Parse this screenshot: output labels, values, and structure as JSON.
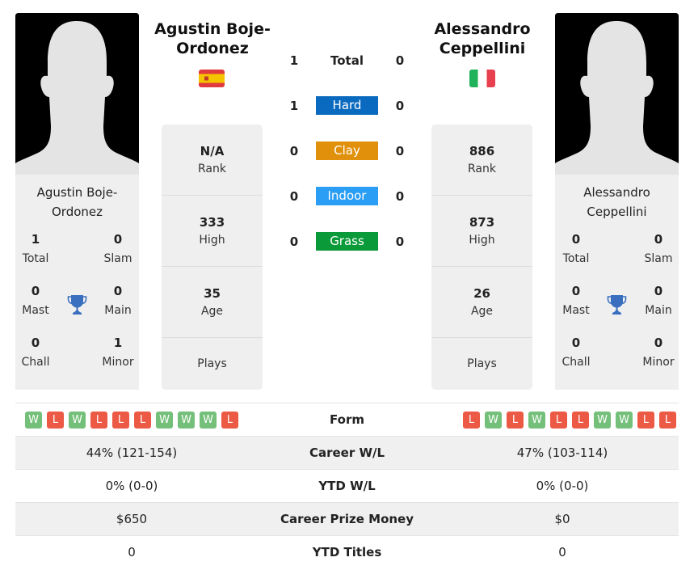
{
  "colors": {
    "hard": "#0a6abf",
    "clay": "#e0900b",
    "indoor": "#2a9df4",
    "grass": "#0b9a3a",
    "win": "#74c07a",
    "loss": "#ec5a45",
    "trophy": "#3a6fc0"
  },
  "player1": {
    "name": "Agustin Boje-Ordonez",
    "name_line1": "Agustin Boje-",
    "name_line2": "Ordonez",
    "flag": "spain-flag",
    "titles": {
      "total": "1",
      "total_label": "Total",
      "slam": "0",
      "slam_label": "Slam",
      "mast": "0",
      "mast_label": "Mast",
      "main": "0",
      "main_label": "Main",
      "chall": "0",
      "chall_label": "Chall",
      "minor": "1",
      "minor_label": "Minor"
    },
    "info": {
      "rank": "N/A",
      "rank_label": "Rank",
      "high": "333",
      "high_label": "High",
      "age": "35",
      "age_label": "Age",
      "plays_label": "Plays"
    },
    "form": [
      "W",
      "L",
      "W",
      "L",
      "L",
      "L",
      "W",
      "W",
      "W",
      "L"
    ]
  },
  "player2": {
    "name": "Alessandro Ceppellini",
    "name_line1": "Alessandro",
    "name_line2": "Ceppellini",
    "flag": "italy-flag",
    "titles": {
      "total": "0",
      "total_label": "Total",
      "slam": "0",
      "slam_label": "Slam",
      "mast": "0",
      "mast_label": "Mast",
      "main": "0",
      "main_label": "Main",
      "chall": "0",
      "chall_label": "Chall",
      "minor": "0",
      "minor_label": "Minor"
    },
    "info": {
      "rank": "886",
      "rank_label": "Rank",
      "high": "873",
      "high_label": "High",
      "age": "26",
      "age_label": "Age",
      "plays_label": "Plays"
    },
    "form": [
      "L",
      "W",
      "L",
      "W",
      "L",
      "L",
      "W",
      "W",
      "L",
      "L"
    ]
  },
  "h2h": [
    {
      "label": "Total",
      "p1": "1",
      "p2": "0"
    },
    {
      "label": "Hard",
      "p1": "1",
      "p2": "0"
    },
    {
      "label": "Clay",
      "p1": "0",
      "p2": "0"
    },
    {
      "label": "Indoor",
      "p1": "0",
      "p2": "0"
    },
    {
      "label": "Grass",
      "p1": "0",
      "p2": "0"
    }
  ],
  "comparison": [
    {
      "label": "Form"
    },
    {
      "label": "Career W/L",
      "p1": "44% (121-154)",
      "p2": "47% (103-114)"
    },
    {
      "label": "YTD W/L",
      "p1": "0% (0-0)",
      "p2": "0% (0-0)"
    },
    {
      "label": "Career Prize Money",
      "p1": "$650",
      "p2": "$0"
    },
    {
      "label": "YTD Titles",
      "p1": "0",
      "p2": "0"
    }
  ]
}
